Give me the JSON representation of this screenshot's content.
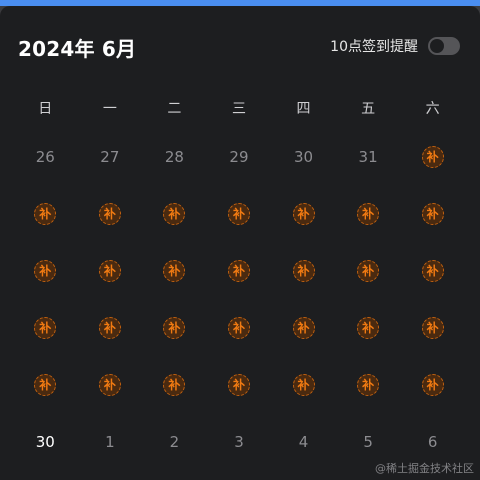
{
  "header": {
    "title": "2024年 6月",
    "reminder_label": "10点签到提醒",
    "reminder_on": false
  },
  "weekdays": [
    "日",
    "一",
    "二",
    "三",
    "四",
    "五",
    "六"
  ],
  "badge_text": "补",
  "weeks": [
    [
      {
        "type": "date",
        "text": "26"
      },
      {
        "type": "date",
        "text": "27"
      },
      {
        "type": "date",
        "text": "28"
      },
      {
        "type": "date",
        "text": "29"
      },
      {
        "type": "date",
        "text": "30"
      },
      {
        "type": "date",
        "text": "31"
      },
      {
        "type": "badge"
      }
    ],
    [
      {
        "type": "badge"
      },
      {
        "type": "badge"
      },
      {
        "type": "badge"
      },
      {
        "type": "badge"
      },
      {
        "type": "badge"
      },
      {
        "type": "badge"
      },
      {
        "type": "badge"
      }
    ],
    [
      {
        "type": "badge"
      },
      {
        "type": "badge"
      },
      {
        "type": "badge"
      },
      {
        "type": "badge"
      },
      {
        "type": "badge"
      },
      {
        "type": "badge"
      },
      {
        "type": "badge"
      }
    ],
    [
      {
        "type": "badge"
      },
      {
        "type": "badge"
      },
      {
        "type": "badge"
      },
      {
        "type": "badge"
      },
      {
        "type": "badge"
      },
      {
        "type": "badge"
      },
      {
        "type": "badge"
      }
    ],
    [
      {
        "type": "badge"
      },
      {
        "type": "badge"
      },
      {
        "type": "badge"
      },
      {
        "type": "badge"
      },
      {
        "type": "badge"
      },
      {
        "type": "badge"
      },
      {
        "type": "badge"
      }
    ],
    [
      {
        "type": "date",
        "text": "30",
        "current": true
      },
      {
        "type": "date",
        "text": "1"
      },
      {
        "type": "date",
        "text": "2"
      },
      {
        "type": "date",
        "text": "3"
      },
      {
        "type": "date",
        "text": "4"
      },
      {
        "type": "date",
        "text": "5"
      },
      {
        "type": "date",
        "text": "6"
      }
    ]
  ],
  "watermark": "@稀土掘金技术社区",
  "colors": {
    "accent_top_bar": "#4a8ef0",
    "background": "#1d1e20",
    "badge_text": "#f07a12",
    "badge_border": "#c4620f"
  }
}
